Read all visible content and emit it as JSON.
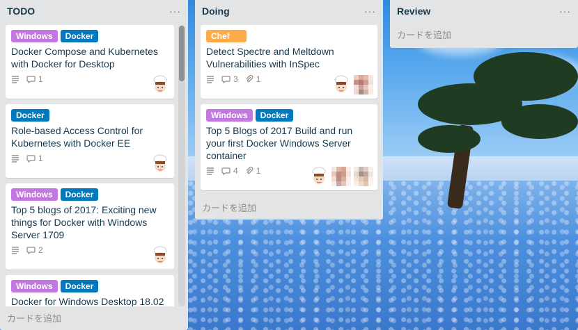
{
  "lists": [
    {
      "title": "TODO",
      "menu": "···",
      "add_card": "カードを追加",
      "cards": [
        {
          "labels": [
            {
              "text": "Windows",
              "color": "windows"
            },
            {
              "text": "Docker",
              "color": "docker"
            }
          ],
          "title": "Docker Compose and Kubernetes with Docker for Desktop",
          "comments": "1"
        },
        {
          "labels": [
            {
              "text": "Docker",
              "color": "docker"
            }
          ],
          "title": "Role-based Access Control for Kubernetes with Docker EE",
          "comments": "1"
        },
        {
          "labels": [
            {
              "text": "Windows",
              "color": "windows"
            },
            {
              "text": "Docker",
              "color": "docker"
            }
          ],
          "title": "Top 5 blogs of 2017: Exciting new things for Docker with Windows Server 1709",
          "comments": "2"
        },
        {
          "labels": [
            {
              "text": "Windows",
              "color": "windows"
            },
            {
              "text": "Docker",
              "color": "docker"
            }
          ],
          "title": "Docker for Windows Desktop 18.02"
        }
      ]
    },
    {
      "title": "Doing",
      "menu": "···",
      "add_card": "カードを追加",
      "cards": [
        {
          "labels": [
            {
              "text": "Chef",
              "color": "chef"
            }
          ],
          "title": "Detect Spectre and Meltdown Vulnerabilities with InSpec",
          "comments": "3",
          "attachments": "1"
        },
        {
          "labels": [
            {
              "text": "Windows",
              "color": "windows"
            },
            {
              "text": "Docker",
              "color": "docker"
            }
          ],
          "title": "Top 5 Blogs of 2017 Build and run your first Docker Windows Server container",
          "comments": "4",
          "attachments": "1"
        }
      ]
    },
    {
      "title": "Review",
      "menu": "···",
      "add_card": "カードを追加"
    }
  ],
  "colors": {
    "windows": "#c377e0",
    "docker": "#0079bf",
    "chef": "#ffab4a",
    "list_bg": "#e2e4e6"
  }
}
